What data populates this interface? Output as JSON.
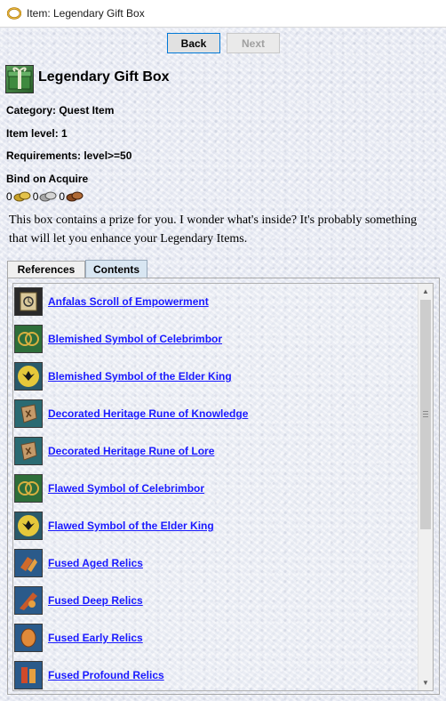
{
  "window": {
    "title": "Item: Legendary Gift Box"
  },
  "nav": {
    "back_label": "Back",
    "next_label": "Next"
  },
  "item": {
    "name": "Legendary Gift Box",
    "category": "Category: Quest Item",
    "item_level": "Item level: 1",
    "requirements": "Requirements: level>=50",
    "binding": "Bind on Acquire",
    "value": {
      "gold": "0",
      "silver": "0",
      "copper": "0"
    },
    "description": "This box contains a prize for you. I wonder what's inside? It's probably something that will let you enhance your Legendary Items."
  },
  "tabs": [
    {
      "label": "References",
      "active": false
    },
    {
      "label": "Contents",
      "active": true
    }
  ],
  "contents": [
    {
      "label": "Anfalas Scroll of Empowerment",
      "icon": "scroll-icon"
    },
    {
      "label": "Blemished Symbol of Celebrimbor",
      "icon": "celebrimbor-symbol-icon"
    },
    {
      "label": "Blemished Symbol of the Elder King",
      "icon": "elder-king-symbol-icon"
    },
    {
      "label": "Decorated Heritage Rune of Knowledge",
      "icon": "heritage-rune-icon"
    },
    {
      "label": "Decorated Heritage Rune of Lore",
      "icon": "heritage-rune-icon"
    },
    {
      "label": "Flawed Symbol of Celebrimbor",
      "icon": "celebrimbor-symbol-icon"
    },
    {
      "label": "Flawed Symbol of the Elder King",
      "icon": "elder-king-symbol-icon"
    },
    {
      "label": "Fused Aged Relics",
      "icon": "relics-icon"
    },
    {
      "label": "Fused Deep Relics",
      "icon": "relics-icon"
    },
    {
      "label": "Fused Early Relics",
      "icon": "relics-icon"
    },
    {
      "label": "Fused Profound Relics",
      "icon": "relics-icon"
    }
  ],
  "colors": {
    "link": "#1a1aff",
    "tab_active": "#d8e6f2"
  }
}
